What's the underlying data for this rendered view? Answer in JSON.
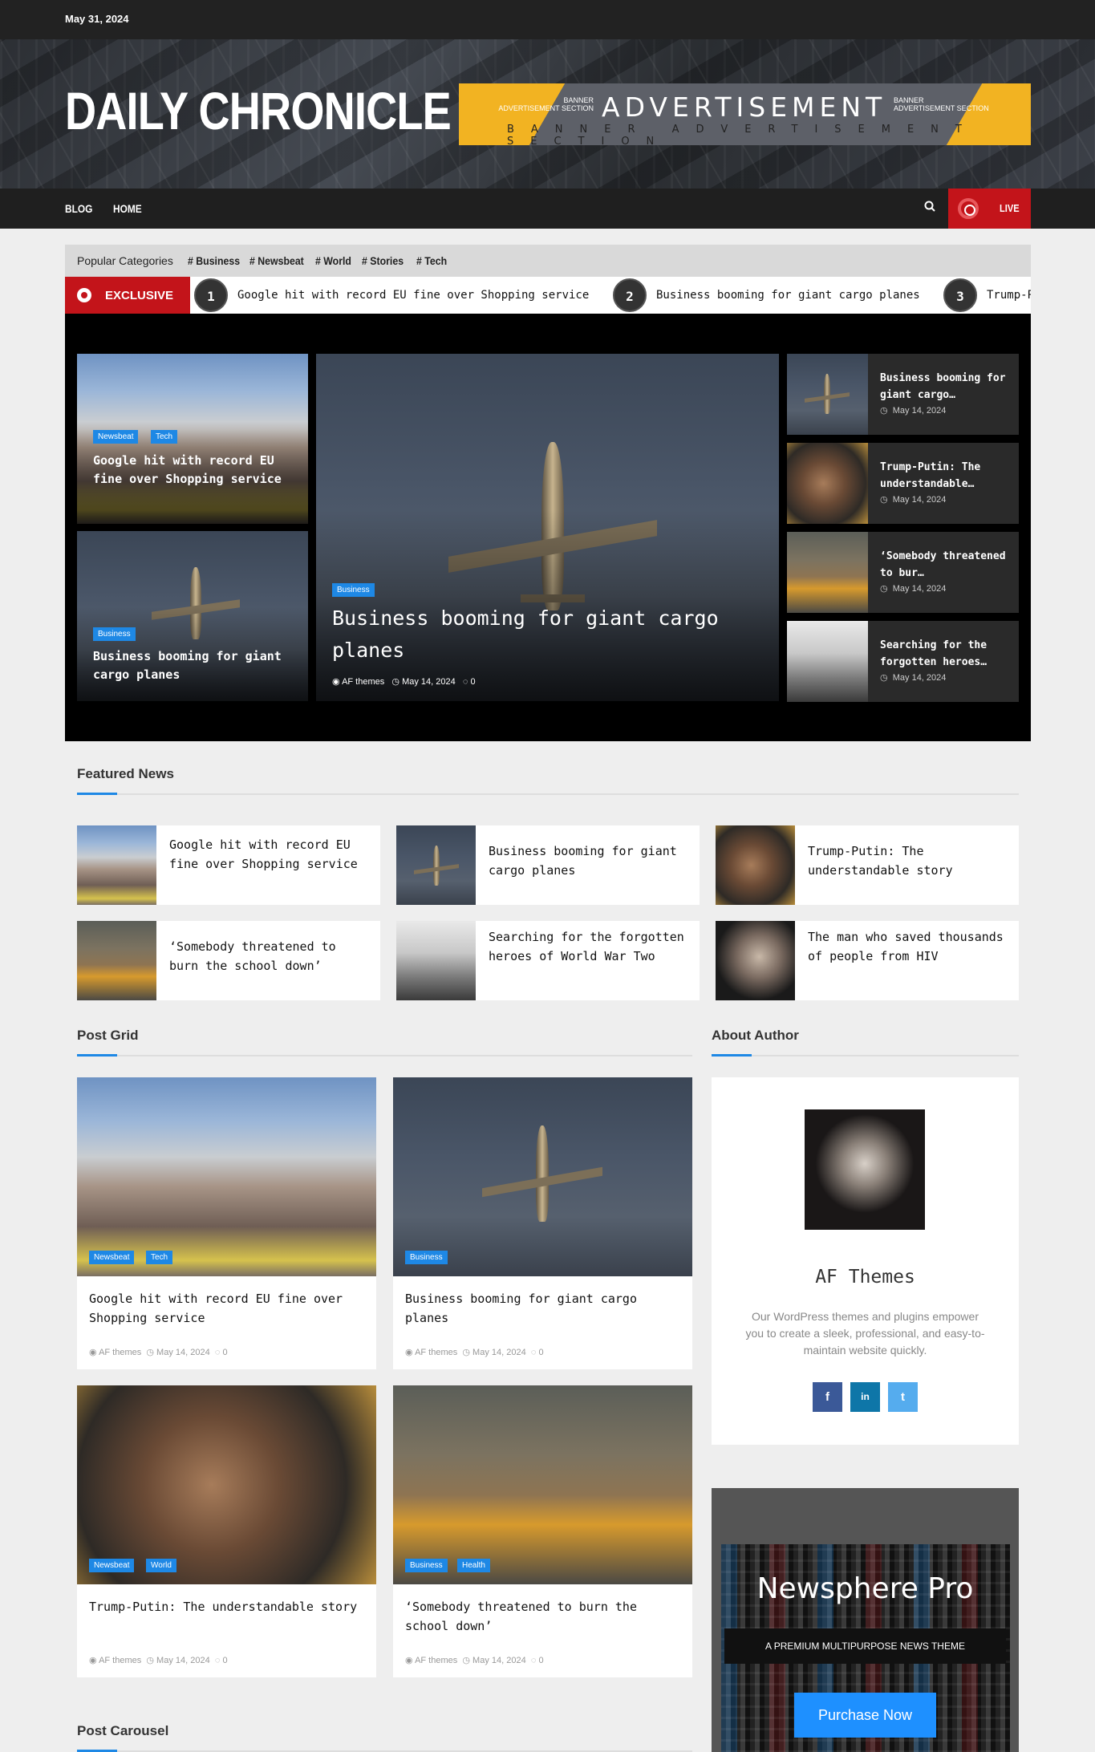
{
  "top": {
    "date": "May 31, 2024"
  },
  "site": {
    "title": "DAILY CHRONICLE"
  },
  "ad": {
    "big": "ADVERTISEMENT",
    "small": "BANNER ADVERTISEMENT SECTION",
    "tag_left_1": "BANNER",
    "tag_left_2": "ADVERTISEMENT SECTION",
    "tag_right_1": "BANNER",
    "tag_right_2": "ADVERTISEMENT SECTION"
  },
  "nav": {
    "items": [
      "BLOG",
      "HOME"
    ],
    "search_icon": "search-icon",
    "live": "LIVE"
  },
  "categories": {
    "label": "Popular Categories",
    "items": [
      "# Business",
      "# Newsbeat",
      "# World",
      "# Stories",
      "# Tech"
    ]
  },
  "ticker": {
    "label": "EXCLUSIVE",
    "items": [
      {
        "num": "1",
        "title": "Google hit with record EU fine over Shopping service"
      },
      {
        "num": "2",
        "title": "Business booming for giant cargo planes"
      },
      {
        "num": "3",
        "title": "Trump-Putin: The understandable story"
      }
    ]
  },
  "hero": {
    "left_top": {
      "tags": [
        "Newsbeat",
        "Tech"
      ],
      "title": "Google hit with record EU fine over Shopping service"
    },
    "left_bottom": {
      "tags": [
        "Business"
      ],
      "title": "Business booming for giant cargo planes"
    },
    "main": {
      "tags": [
        "Business"
      ],
      "title": "Business booming for giant cargo planes",
      "author": "AF themes",
      "date": "May 14, 2024",
      "comments": "0"
    },
    "side": [
      {
        "title": "Business booming for giant cargo…",
        "date": "May 14, 2024"
      },
      {
        "title": "Trump-Putin: The understandable…",
        "date": "May 14, 2024"
      },
      {
        "title": "‘Somebody threatened to bur…",
        "date": "May 14, 2024"
      },
      {
        "title": "Searching for the forgotten heroes…",
        "date": "May 14, 2024"
      }
    ]
  },
  "featured": {
    "heading": "Featured News",
    "items": [
      "Google hit with record EU fine over Shopping service",
      "Business booming for giant cargo planes",
      "Trump-Putin: The understandable story",
      "‘Somebody threatened to burn the school down’",
      "Searching for the forgotten heroes of World War Two",
      "The man who saved thousands of people from HIV"
    ]
  },
  "post_grid": {
    "heading": "Post Grid",
    "items": [
      {
        "tags": [
          "Newsbeat",
          "Tech"
        ],
        "title": "Google hit with record EU fine over Shopping service",
        "author": "AF themes",
        "date": "May 14, 2024",
        "comments": "0"
      },
      {
        "tags": [
          "Business"
        ],
        "title": "Business booming for giant cargo planes",
        "author": "AF themes",
        "date": "May 14, 2024",
        "comments": "0"
      },
      {
        "tags": [
          "Newsbeat",
          "World"
        ],
        "title": "Trump-Putin: The understandable story",
        "author": "AF themes",
        "date": "May 14, 2024",
        "comments": "0"
      },
      {
        "tags": [
          "Business",
          "Health"
        ],
        "title": "‘Somebody threatened to burn the school down’",
        "author": "AF themes",
        "date": "May 14, 2024",
        "comments": "0"
      }
    ]
  },
  "about": {
    "heading": "About Author",
    "name": "AF Themes",
    "desc": "Our WordPress themes and plugins empower you to create a sleek, professional, and easy-to-maintain website quickly.",
    "social": [
      "f",
      "in",
      "t"
    ]
  },
  "promo": {
    "title": "Newsphere Pro",
    "subtitle": "A PREMIUM MULTIPURPOSE NEWS THEME",
    "button": "Purchase Now"
  },
  "carousel": {
    "heading": "Post Carousel"
  },
  "colors": {
    "accent": "#1e88e5",
    "live_red": "#c3141a",
    "ad_yellow": "#f2b322"
  }
}
